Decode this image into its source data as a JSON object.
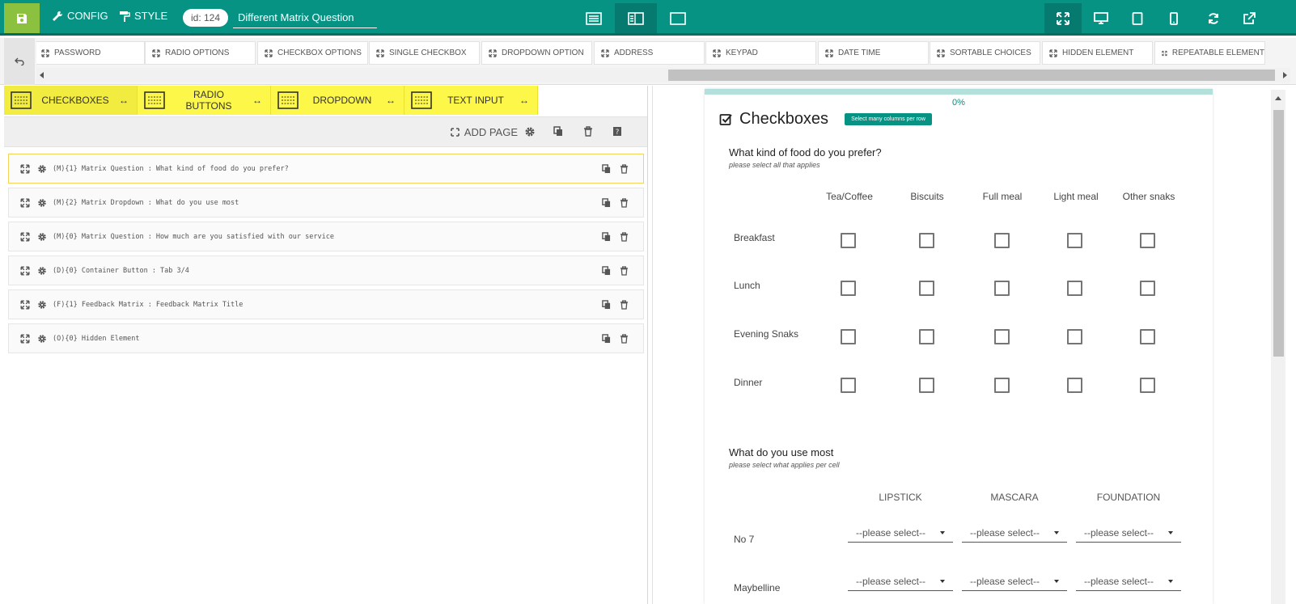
{
  "topbar": {
    "config_label": "CONFIG",
    "style_label": "STYLE",
    "id_label": "id: 124",
    "title_value": "Different Matrix Question"
  },
  "palette": {
    "items": [
      "PASSWORD",
      "RADIO OPTIONS",
      "CHECKBOX OPTIONS",
      "SINGLE CHECKBOX",
      "DROPDOWN OPTION",
      "ADDRESS",
      "KEYPAD",
      "DATE TIME",
      "SORTABLE CHOICES",
      "HIDDEN ELEMENT",
      "REPEATABLE ELEMENT"
    ]
  },
  "matrix_tabs": [
    "CHECKBOXES",
    "RADIO BUTTONS",
    "DROPDOWN",
    "TEXT INPUT"
  ],
  "page_bar": {
    "add_page_label": "ADD PAGE"
  },
  "questions": [
    "(M){1} Matrix Question : What kind of food do you prefer?",
    "(M){2} Matrix Dropdown : What do you use most",
    "(M){0} Matrix Question : How much are you satisfied with our service",
    "(D){0} Container Button : Tab 3/4",
    "(F){1} Feedback Matrix : Feedback Matrix Title",
    "(O){0} Hidden Element"
  ],
  "preview": {
    "progress_label": "0%",
    "progress_value": 0,
    "form_title": "Checkboxes",
    "badge": "Select many columns per row",
    "q1": {
      "title": "What kind of food do you prefer?",
      "subtitle": "please select all that applies",
      "columns": [
        "Tea/Coffee",
        "Biscuits",
        "Full meal",
        "Light meal",
        "Other snaks"
      ],
      "rows": [
        "Breakfast",
        "Lunch",
        "Evening Snaks",
        "Dinner"
      ]
    },
    "q2": {
      "title": "What do you use most",
      "subtitle": "please select what applies per cell",
      "columns": [
        "LIPSTICK",
        "MASCARA",
        "FOUNDATION"
      ],
      "rows": [
        "No 7",
        "Maybelline"
      ],
      "placeholder": "--please select--"
    }
  },
  "colors": {
    "primary": "#079384",
    "save": "#8cc13f",
    "highlight": "#fdf74a"
  }
}
